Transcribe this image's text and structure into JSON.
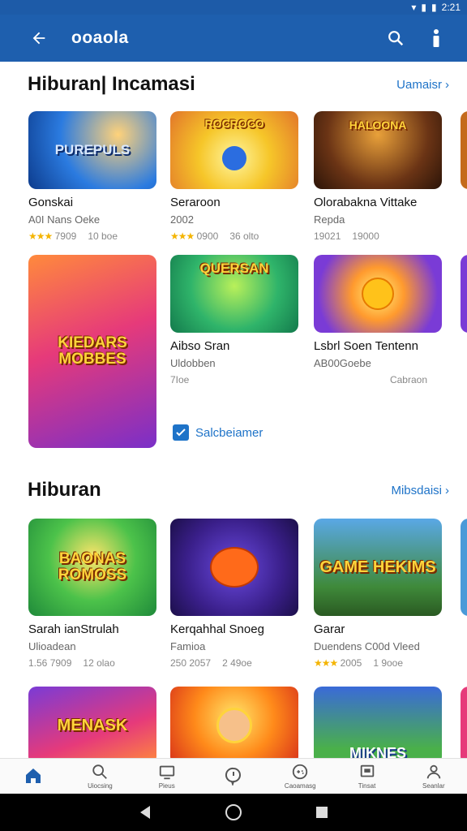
{
  "status_bar": {
    "time": "2:21"
  },
  "app_bar": {
    "title": "ooaola"
  },
  "sections": [
    {
      "title": "Hiburan| Incamasi",
      "more": "Uamaisr",
      "cards": [
        {
          "thumb": "PUREPULS",
          "name": "Gonskai",
          "sub": "A0I Nans Oeke",
          "rating": "7909",
          "count": "10 boe"
        },
        {
          "thumb": "ROCROCO",
          "name": "Seraroon",
          "sub": "2002",
          "rating": "0900",
          "count": "36 olto"
        },
        {
          "thumb": "HALOONA",
          "name": "Olorabakna Vittake",
          "sub": "Repda",
          "rating": "19021",
          "count": "19000"
        },
        {
          "thumb": "KIEDARS MOBBES",
          "name": "",
          "sub": "",
          "rating": "",
          "count": ""
        },
        {
          "thumb": "QUERSAN",
          "name": "Aibso Sran",
          "sub": "Uldobben",
          "rating": "7Ioe",
          "count": ""
        },
        {
          "thumb": "",
          "name": "Lsbrl Soen Tentenn",
          "sub": "AB00Goebe",
          "rating": "",
          "count": "Cabraon"
        }
      ],
      "checkbox_label": "Salcbeiamer"
    },
    {
      "title": "Hiburan",
      "more": "Mibsdaisi",
      "cards": [
        {
          "thumb": "BAONAS ROMOSS",
          "name": "Sarah ianStrulah",
          "sub": "Ulioadean",
          "rating": "1.56 7909",
          "count": "12 olao"
        },
        {
          "thumb": "",
          "name": "Kerqahhal Snoeg",
          "sub": "Famioa",
          "rating": "250 2057",
          "count": "2 49oe"
        },
        {
          "thumb": "GAME HEKIMS",
          "name": "Garar",
          "sub": "Duendens C00d Vleed",
          "rating": "2005",
          "count": "1 9ooe"
        },
        {
          "thumb": "MENASK",
          "name": "",
          "sub": "",
          "rating": "",
          "count": ""
        },
        {
          "thumb": "",
          "name": "",
          "sub": "",
          "rating": "",
          "count": ""
        },
        {
          "thumb": "MIKNES",
          "name": "",
          "sub": "",
          "rating": "",
          "count": ""
        }
      ]
    }
  ],
  "bottom_nav": [
    {
      "icon": "home-icon",
      "label": ""
    },
    {
      "icon": "search-icon",
      "label": "Uiocsing"
    },
    {
      "icon": "tv-icon",
      "label": "Pieus"
    },
    {
      "icon": "timer-icon",
      "label": ""
    },
    {
      "icon": "gamepad-icon",
      "label": "Caoamasg"
    },
    {
      "icon": "screen-icon",
      "label": "Tinsat"
    },
    {
      "icon": "profile-icon",
      "label": "Seanlar"
    }
  ],
  "colors": {
    "primary": "#1e5fae",
    "accent": "#1e73c8",
    "star": "#f4b400"
  }
}
